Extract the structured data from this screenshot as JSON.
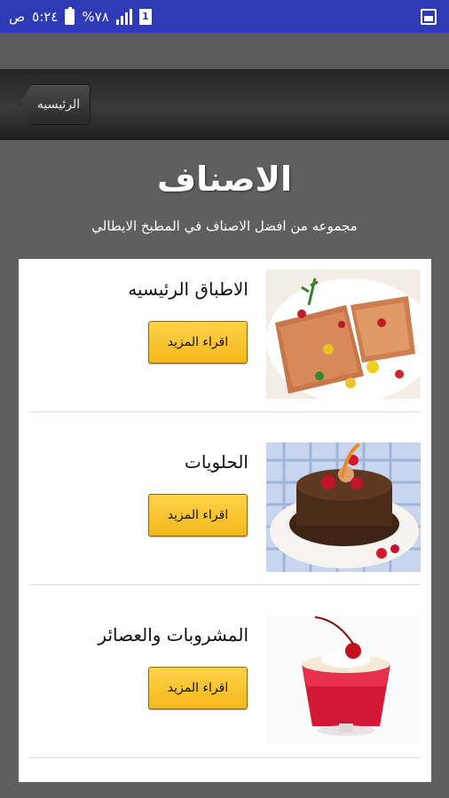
{
  "status_bar": {
    "period": "ص",
    "time": "٥:٢٤",
    "battery": "%٧٨",
    "sim": "1"
  },
  "header": {
    "back_label": "الرئيسيه"
  },
  "page": {
    "title": "الاصناف",
    "subtitle": "مجموعه من افضل الاصناف في المطبخ الايطالي"
  },
  "categories": [
    {
      "title": "الاطباق الرئيسيه",
      "button_label": "اقراء المزيد",
      "image": "salmon-dish"
    },
    {
      "title": "الحلويات",
      "button_label": "اقراء المزيد",
      "image": "chocolate-cake"
    },
    {
      "title": "المشروبات والعصائر",
      "button_label": "اقراء المزيد",
      "image": "red-jelly-dessert"
    }
  ]
}
